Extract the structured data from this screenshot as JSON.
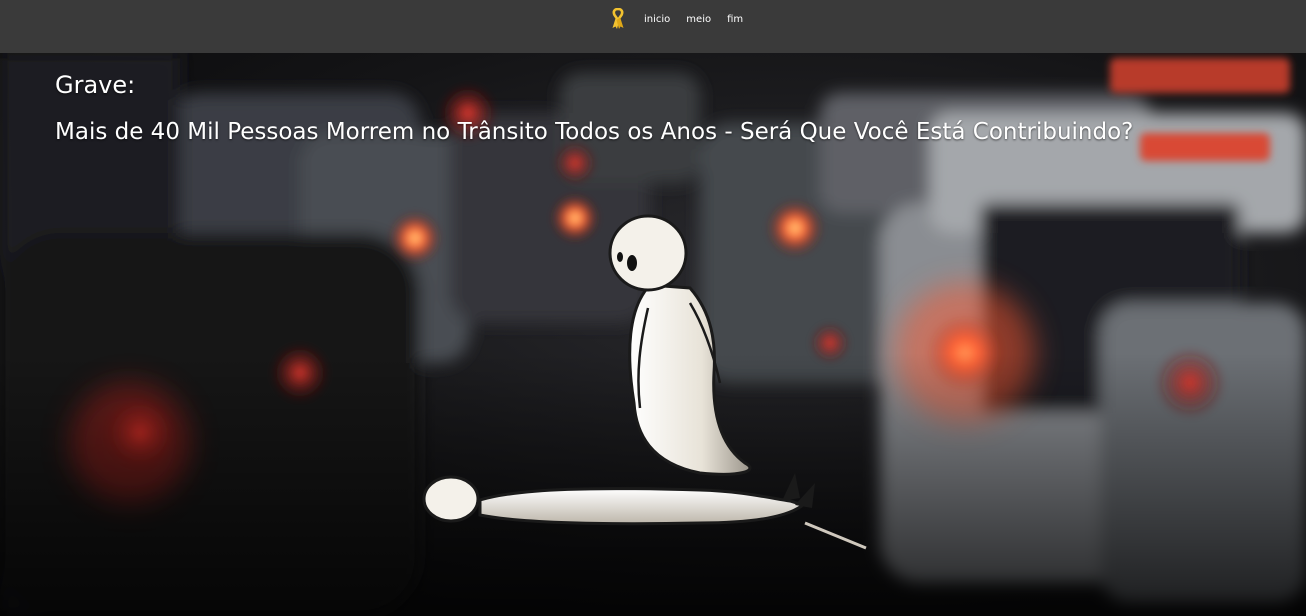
{
  "nav": {
    "logo_icon": "yellow-ribbon-icon",
    "items": [
      {
        "label": "inicio"
      },
      {
        "label": "meio"
      },
      {
        "label": "fim"
      }
    ],
    "ribbon_color": "#f2c230"
  },
  "hero": {
    "kicker": "Grave:",
    "title": "Mais de 40 Mil Pessoas Morrem no Trânsito Todos os Anos - Será Que Você Está Contribuindo?",
    "background": "night-traffic-blurred-cars",
    "illustration": "ghost-rising-from-body"
  },
  "colors": {
    "topbar": "#3a3a3a",
    "text": "#ffffff",
    "tail_light": "#e0332a"
  }
}
